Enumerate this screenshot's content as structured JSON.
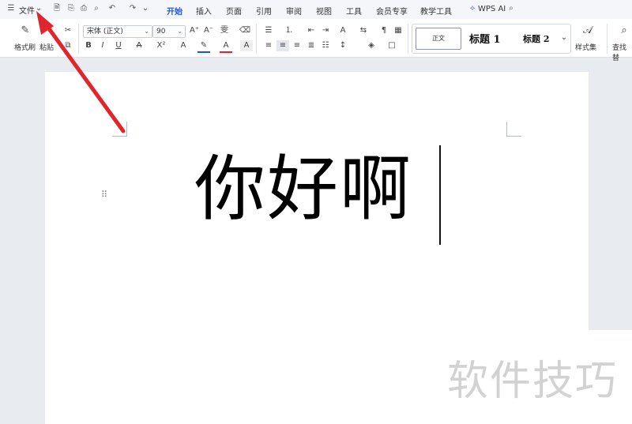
{
  "menubar": {
    "file_label": "文件",
    "tabs": [
      "开始",
      "插入",
      "页面",
      "引用",
      "审阅",
      "视图",
      "工具",
      "会员专享",
      "教学工具"
    ],
    "wps_ai": "WPS AI"
  },
  "ribbon": {
    "format_painter": "格式刷",
    "paste": "粘贴",
    "font_family": "宋体 (正文)",
    "font_size": "90",
    "style_normal": "正文",
    "style_h1": "标题 1",
    "style_h2": "标题 2",
    "style_set": "样式集",
    "find_replace": "查找替"
  },
  "document": {
    "text": "你好啊"
  },
  "watermark": "软件技巧",
  "colors": {
    "accent": "#1a56d6",
    "arrow": "#e0262d"
  }
}
